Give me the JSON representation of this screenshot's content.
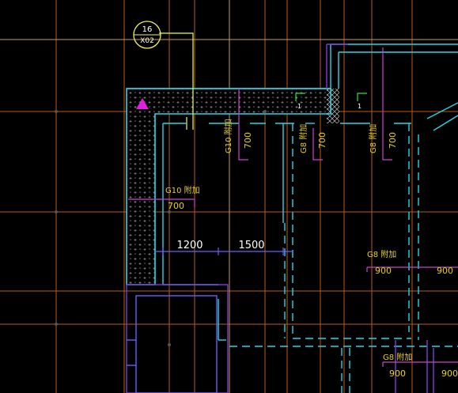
{
  "colors": {
    "background": "#000000",
    "grid_orange": "#b85a1e",
    "grid_amber": "#c8a040",
    "cyan": "#2ad4e6",
    "magenta": "#d040d0",
    "purple": "#7a3cd8",
    "blue": "#6a5cff",
    "yellow_text": "#e8d020",
    "green": "#30e030",
    "white": "#ffffff"
  },
  "grid_marker": {
    "number": "16",
    "sheet": "X02"
  },
  "dimensions": {
    "d1200": "1200",
    "d1500": "1500"
  },
  "rebar_labels": {
    "g10_vertical": "G10 附加",
    "g8_vertical_a": "G8 附加",
    "g8_vertical_b": "G8 附加",
    "g10_horizontal": "G10 附加",
    "g8_horizontal_a": "G8 附加",
    "g8_horizontal_b": "G8 附加"
  },
  "rebar_lengths": {
    "v1": "700",
    "v2": "700",
    "v3": "700",
    "h1": "700",
    "h2a": "900",
    "h2b": "900",
    "h3": "900",
    "h3b": "900"
  },
  "section_marks": {
    "left": "1",
    "right": "1"
  },
  "icons": [
    "triangle-marker-icon"
  ]
}
